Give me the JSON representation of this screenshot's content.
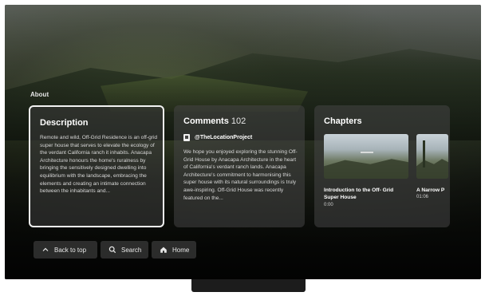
{
  "section": {
    "label": "About"
  },
  "description": {
    "title": "Description",
    "text": "Remote and wild, Off-Grid Residence is an off-grid super house that serves to elevate the ecology of the verdant California ranch it inhabits. Anacapa Architecture honours the home's ruralness by bringing the sensitively designed dwelling into equilibrium with the landscape, embracing the elements and creating an intimate connection between the inhabitants and..."
  },
  "comments": {
    "title": "Comments",
    "count": "102",
    "channel": "@TheLocationProject",
    "text": "We hope you enjoyed exploring the stunning Off-Grid House by Anacapa Architecture in the heart of California's verdant ranch lands. Anacapa Architecture's commitment to harmonising this super house with its natural surroundings is truly awe-inspiring. Off-Grid House was recently featured on the..."
  },
  "chapters": {
    "title": "Chapters",
    "items": [
      {
        "title": "Introduction to the Off- Grid Super House",
        "time": "0:00"
      },
      {
        "title": "A Narrow P",
        "time": "01:06"
      }
    ]
  },
  "nav": {
    "back": "Back to top",
    "search": "Search",
    "home": "Home"
  }
}
